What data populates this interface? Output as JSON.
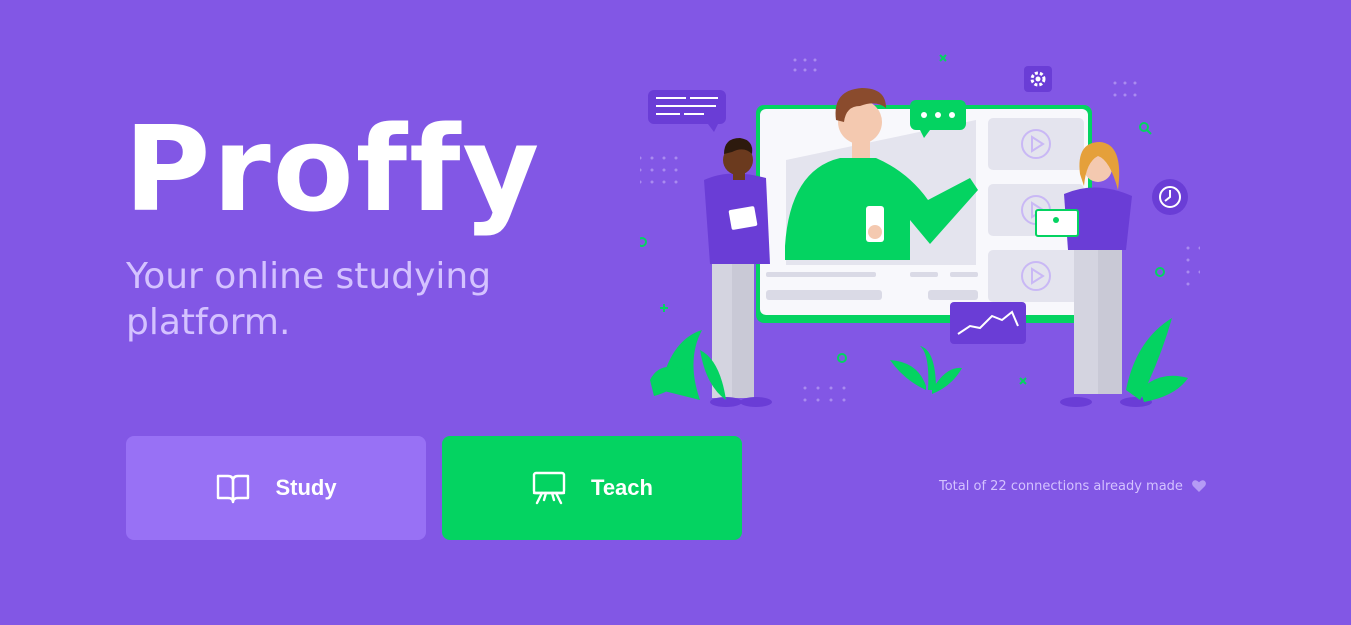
{
  "brand": {
    "logo_text": "Proffy"
  },
  "hero": {
    "tagline_line1": "Your online studying",
    "tagline_line2": "platform."
  },
  "buttons": {
    "study_label": "Study",
    "study_icon": "book-open-icon",
    "teach_label": "Teach",
    "teach_icon": "presentation-board-icon"
  },
  "stats": {
    "connections_text": "Total of 22 connections already made",
    "connections_icon": "heart-icon"
  },
  "colors": {
    "background": "#8257E5",
    "study_button": "#9871F5",
    "teach_button": "#04D361",
    "tagline": "#D4C2FF",
    "text_light": "#FFFFFF"
  }
}
